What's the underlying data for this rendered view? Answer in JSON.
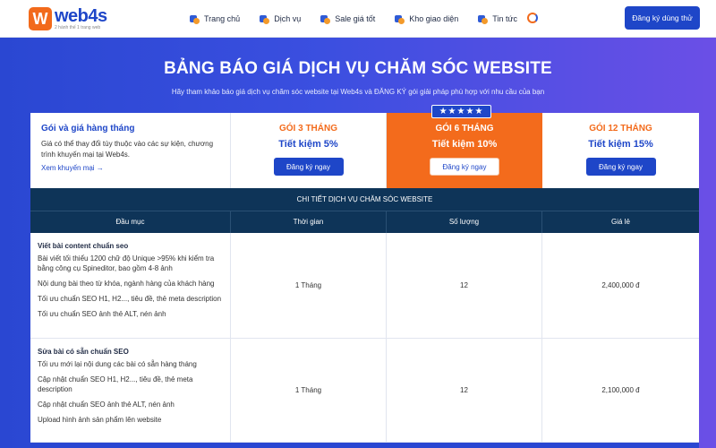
{
  "header": {
    "logo_letter": "W",
    "logo_name": "web4s",
    "logo_slogan": "2 hành thế 1 trang web",
    "nav": [
      {
        "label": "Trang chủ",
        "icon": "home-icon"
      },
      {
        "label": "Dịch vụ",
        "icon": "services-icon"
      },
      {
        "label": "Sale giá tốt",
        "icon": "sale-icon"
      },
      {
        "label": "Kho giao diện",
        "icon": "themes-icon"
      },
      {
        "label": "Tin tức",
        "icon": "news-icon"
      }
    ],
    "cta": "Đăng ký dùng thử"
  },
  "hero": {
    "title": "BẢNG BÁO GIÁ DỊCH VỤ CHĂM SÓC WEBSITE",
    "subtitle": "Hãy tham khảo báo giá dịch vụ chăm sóc website tại Web4s và ĐĂNG KÝ gói giải pháp phù hợp với nhu cầu của bạn"
  },
  "pricing": {
    "intro": {
      "title": "Gói và giá hàng tháng",
      "desc": "Giá có thể thay đổi tùy thuộc vào các sự kiện, chương trình khuyến mại tại Web4s.",
      "link": "Xem khuyến mại →"
    },
    "stars": "★★★★★",
    "plans": [
      {
        "name": "GÓI 3 THÁNG",
        "save": "Tiết kiệm 5%",
        "button": "Đăng ký ngay"
      },
      {
        "name": "GÓI 6 THÁNG",
        "save": "Tiết kiệm 10%",
        "button": "Đăng ký ngay"
      },
      {
        "name": "GÓI 12 THÁNG",
        "save": "Tiết kiệm 15%",
        "button": "Đăng ký ngay"
      }
    ],
    "details_title": "CHI TIẾT DỊCH VỤ CHĂM SÓC WEBSITE",
    "columns": [
      "Đầu mục",
      "Thời gian",
      "Số lượng",
      "Giá lẻ"
    ],
    "rows": [
      {
        "title": "Viết bài content chuẩn seo",
        "lines": [
          "Bài viết tối thiểu 1200 chữ độ Unique >95% khi kiểm tra bằng công cụ Spineditor, bao gồm 4-8 ảnh",
          "Nội dung bài theo từ khóa, ngành hàng của khách hàng",
          "Tối ưu chuẩn SEO H1, H2..., tiêu đề, thẻ meta description",
          "Tối ưu chuẩn SEO ảnh thẻ ALT, nén ảnh"
        ],
        "time": "1 Tháng",
        "qty": "12",
        "price": "2,400,000 đ"
      },
      {
        "title": "Sửa bài có sẵn chuẩn SEO",
        "lines": [
          "Tối ưu mới lại nội dung các bài có sẵn hàng tháng",
          "Cập nhật chuẩn SEO H1, H2..., tiêu đề, thẻ meta description",
          "Cập nhật chuẩn SEO ảnh thẻ ALT, nén ảnh",
          "Upload hình ảnh sản phẩm lên website"
        ],
        "time": "1 Tháng",
        "qty": "12",
        "price": "2,100,000 đ"
      }
    ]
  },
  "colors": {
    "primary": "#1e46c8",
    "accent": "#f36b1c",
    "table_header": "#0e3458"
  }
}
